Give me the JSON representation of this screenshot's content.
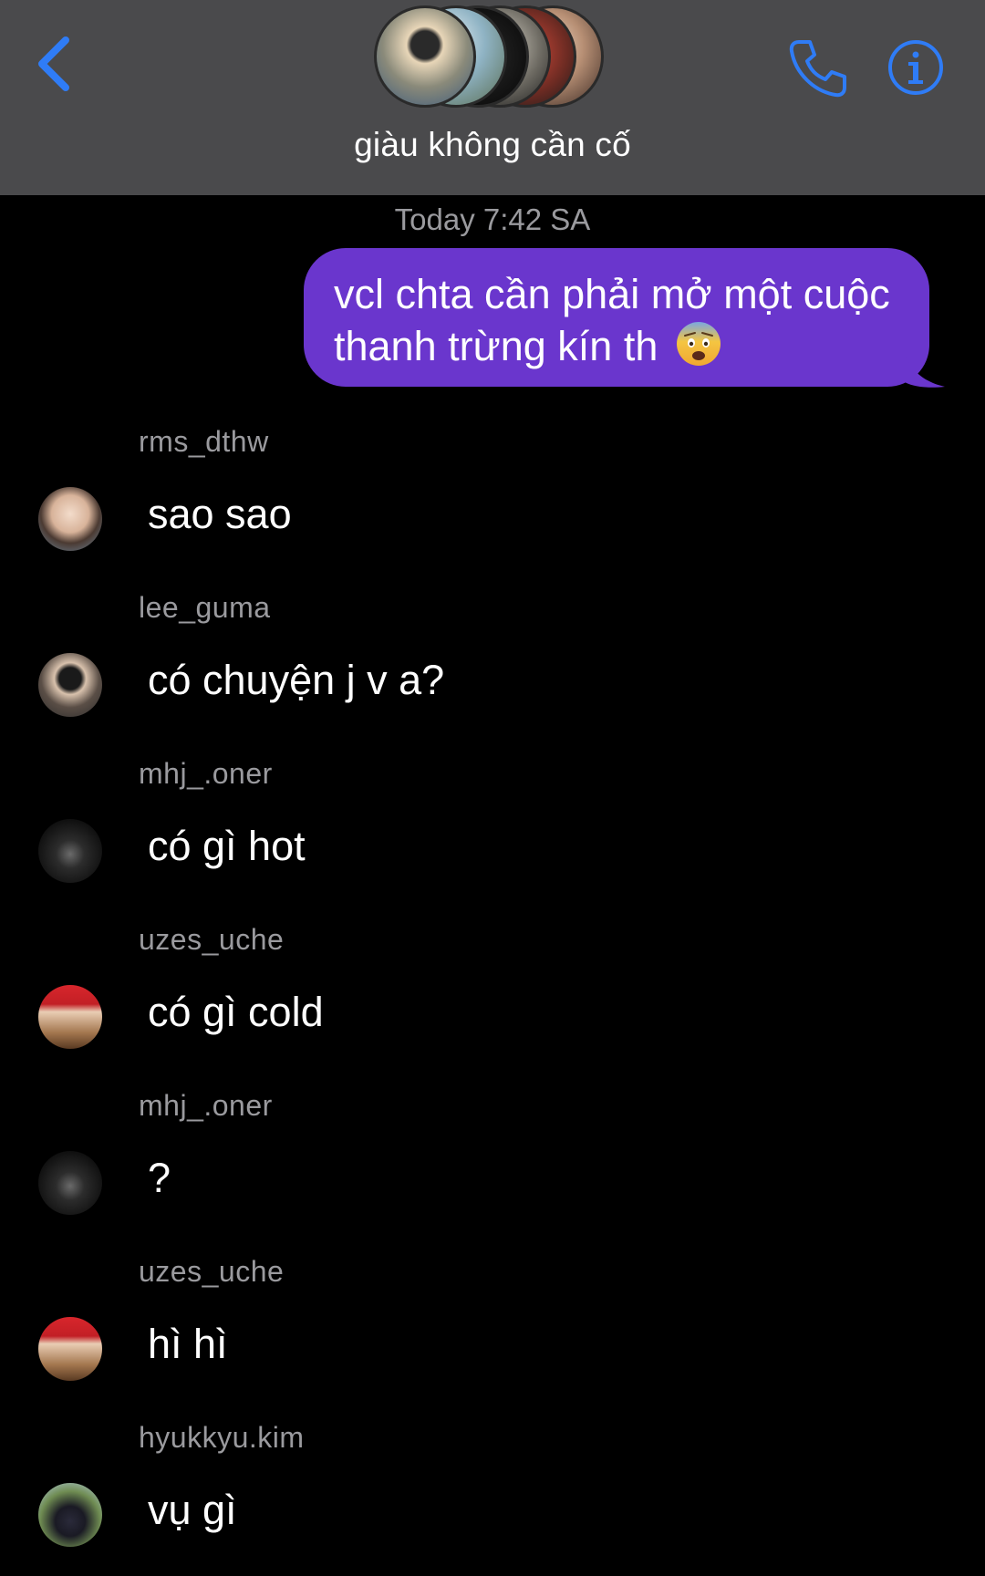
{
  "header": {
    "title": "giàu không cần cố",
    "back_icon": "chevron-left-icon",
    "call_icon": "phone-icon",
    "info_icon": "info-icon",
    "accent_color": "#2f7cf6",
    "background_color": "#4a4a4c"
  },
  "conversation": {
    "timestamp": "Today 7:42 SA",
    "outgoing_bubble_color": "#6a36cd",
    "outgoing": [
      {
        "line1": "vcl chta cần phải mở một cuộc",
        "line2": "thanh trừng kín th",
        "emoji": "😨"
      }
    ],
    "incoming": [
      {
        "sender": "rms_dthw",
        "text": "sao sao"
      },
      {
        "sender": "lee_guma",
        "text": "có chuyện j v a?"
      },
      {
        "sender": "mhj_.oner",
        "text": "có gì hot"
      },
      {
        "sender": "uzes_uche",
        "text": "có gì cold"
      },
      {
        "sender": "mhj_.oner",
        "text": "?"
      },
      {
        "sender": "uzes_uche",
        "text": "hì hì"
      },
      {
        "sender": "hyukkyu.kim",
        "text": "vụ gì"
      }
    ]
  }
}
